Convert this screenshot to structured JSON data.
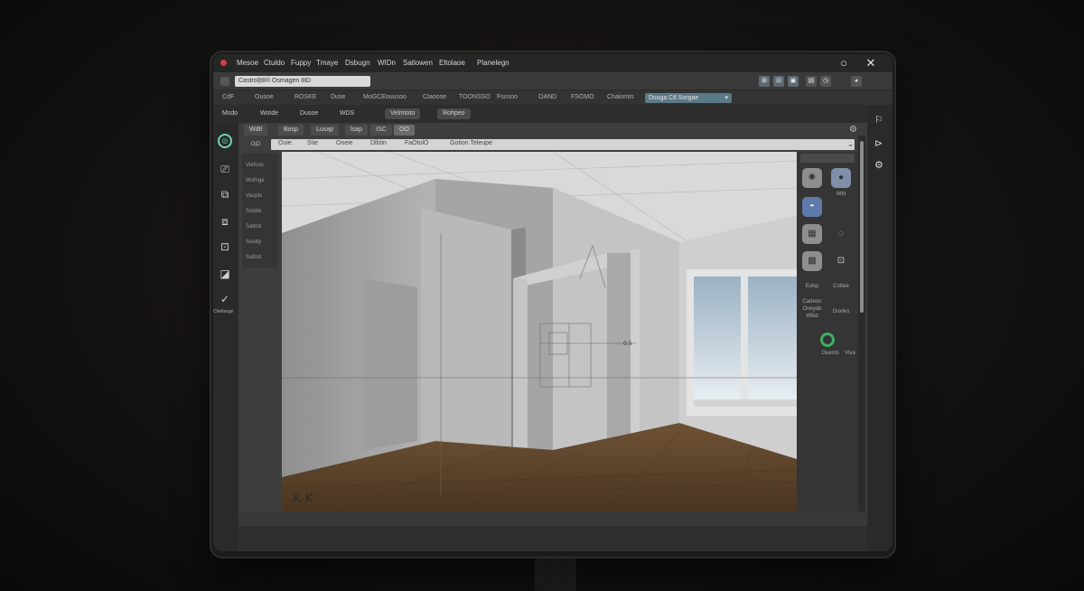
{
  "titlebar": {
    "menu": [
      "Mesoe",
      "Ctuldo",
      "Fuppy",
      "Tmaye",
      "Dsbugn",
      "WIDn",
      "Satlowen",
      "Eltolaoe",
      "Planelegn"
    ],
    "window_buttons": {
      "maximize": "○",
      "close": "✕"
    }
  },
  "toolbar": {
    "address": "Castrol|t8® Osmagen 8ID",
    "buttons": [
      "⊞",
      "⊟",
      "▣",
      "▤",
      "◷",
      "◕"
    ]
  },
  "menu2": {
    "items": [
      "CdF",
      "Ousoe",
      "ROSKE",
      "Duse",
      "MoGCEouusoo",
      "Ctaoose",
      "TOONSSO",
      "Fsnsoo",
      "OAND",
      "FSOMO",
      "Chaiomts"
    ],
    "selected": "Dsuga Ctl Sorgae"
  },
  "menu3": {
    "items": [
      "Msdo",
      "Wotde",
      "Dusoe",
      "WDS"
    ],
    "pills": [
      "Velmtoto",
      "Rohpeo"
    ]
  },
  "left_icons": [
    "◎",
    "⎚",
    "⧉",
    "⧈",
    "⊡",
    "◪",
    "✓"
  ],
  "left_icon_caption": "Chelieogn",
  "tabs": [
    "Wdtl",
    "Bosp",
    "Lusap",
    "lsap",
    "ISC",
    "OO"
  ],
  "viewbar": {
    "active": "O|D",
    "items": [
      "Ouie",
      "Stie",
      "Oneie",
      "Dlbtin",
      "FaOtolO",
      "Gotion Teleupe"
    ]
  },
  "outline_items": [
    "Viefoos",
    "Wofnge",
    "Vaoplo",
    "Sotdte",
    "Saltnd",
    "Soaltp",
    "Satlnd"
  ],
  "viewport": {
    "corner_mark": "K K",
    "dimension_label": "0.5"
  },
  "right_panel": {
    "labels": [
      "Wbl",
      "Eolsp",
      "Cottee",
      "Cadeon Oneyde Wlkd",
      "Ouvles",
      "Ouesto",
      "Vlva"
    ]
  },
  "right_side_icons": [
    "⚐",
    "⊳",
    "⚙",
    "✕"
  ],
  "colors": {
    "accent": "#5a7a86",
    "record": "#d2403a",
    "green": "#3fae63"
  }
}
